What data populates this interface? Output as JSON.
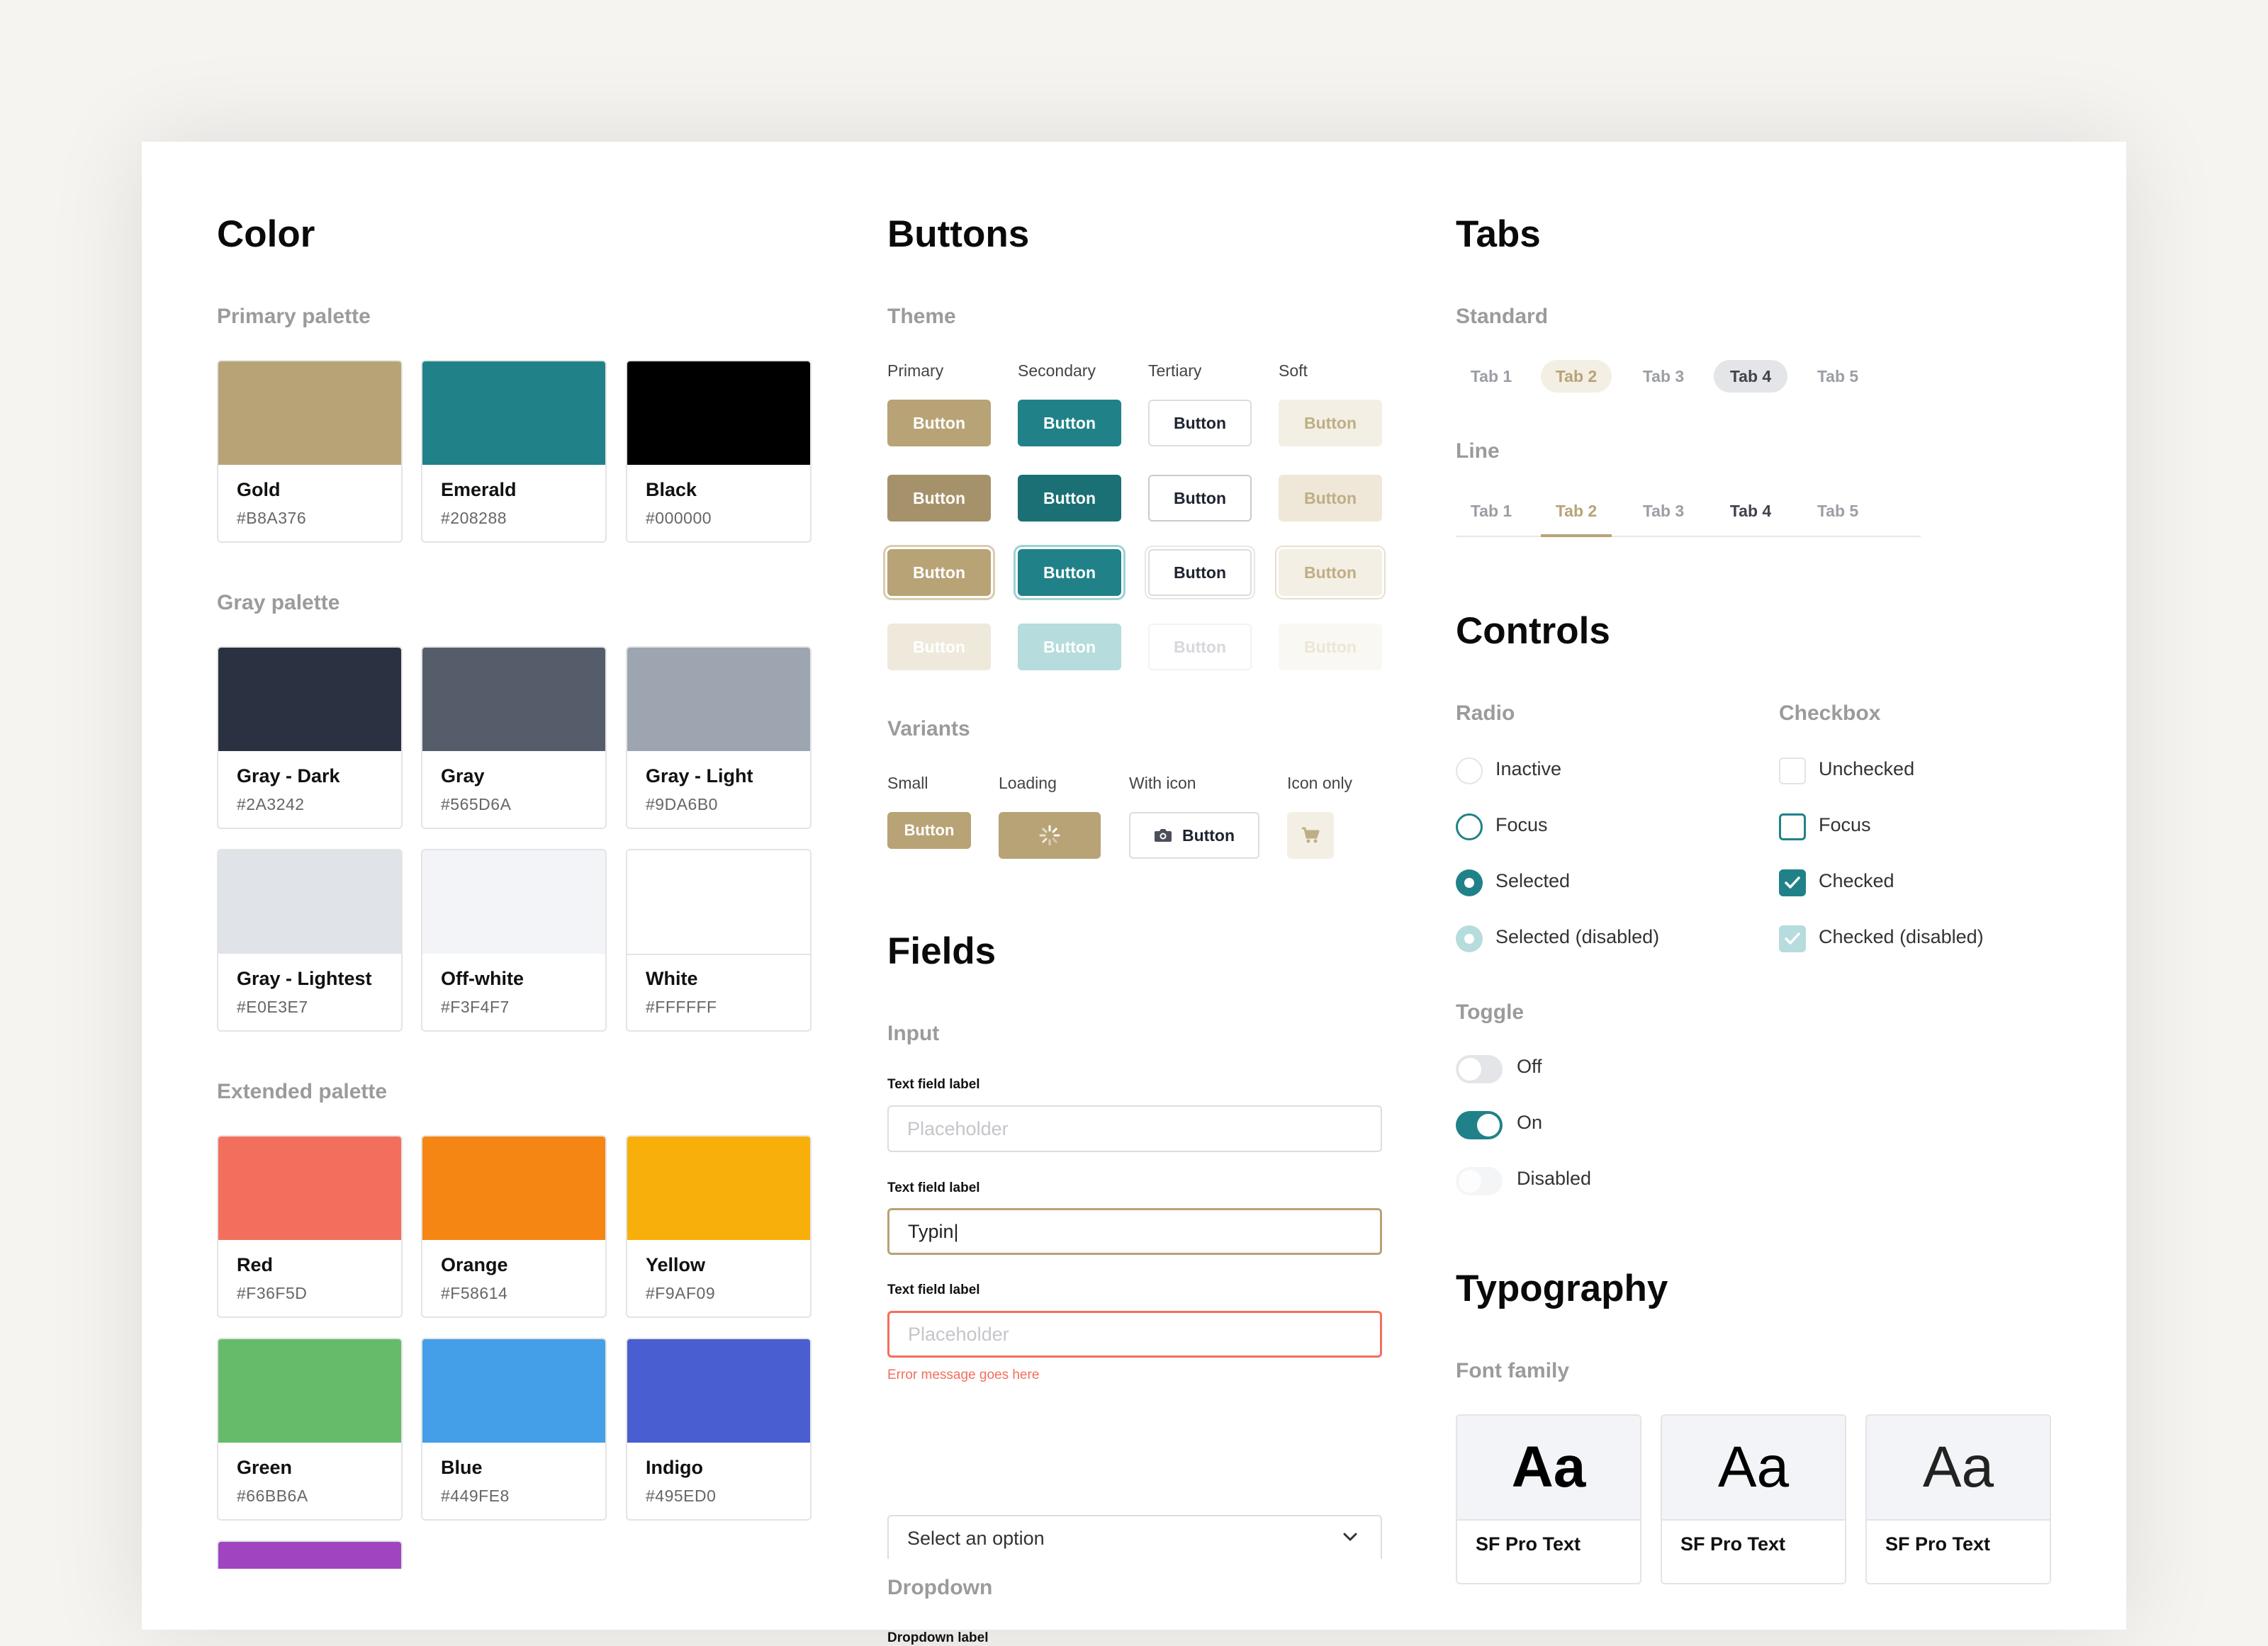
{
  "color": {
    "title": "Color",
    "primary_heading": "Primary palette",
    "gray_heading": "Gray palette",
    "extended_heading": "Extended palette",
    "primary": [
      {
        "name": "Gold",
        "hex": "#B8A376"
      },
      {
        "name": "Emerald",
        "hex": "#208288"
      },
      {
        "name": "Black",
        "hex": "#000000"
      }
    ],
    "gray": [
      {
        "name": "Gray - Dark",
        "hex": "#2A3242"
      },
      {
        "name": "Gray",
        "hex": "#565D6A"
      },
      {
        "name": "Gray - Light",
        "hex": "#9DA6B0"
      },
      {
        "name": "Gray - Lightest",
        "hex": "#E0E3E7"
      },
      {
        "name": "Off-white",
        "hex": "#F3F4F7"
      },
      {
        "name": "White",
        "hex": "#FFFFFF"
      }
    ],
    "extended": [
      {
        "name": "Red",
        "hex": "#F36F5D"
      },
      {
        "name": "Orange",
        "hex": "#F58614"
      },
      {
        "name": "Yellow",
        "hex": "#F9AF09"
      },
      {
        "name": "Green",
        "hex": "#66BB6A"
      },
      {
        "name": "Blue",
        "hex": "#449FE8"
      },
      {
        "name": "Indigo",
        "hex": "#495ED0"
      }
    ],
    "partial_swatch_color": "#A044C0"
  },
  "buttons": {
    "title": "Buttons",
    "theme_heading": "Theme",
    "columns": [
      "Primary",
      "Secondary",
      "Tertiary",
      "Soft"
    ],
    "button_label": "Button",
    "variants_heading": "Variants",
    "variant_labels": [
      "Small",
      "Loading",
      "With icon",
      "Icon only"
    ],
    "small_label": "Button",
    "with_icon_label": "Button"
  },
  "fields": {
    "title": "Fields",
    "input_heading": "Input",
    "inputs": [
      {
        "label": "Text field label",
        "placeholder": "Placeholder",
        "value": ""
      },
      {
        "label": "Text field label",
        "placeholder": "Placeholder",
        "value": "Typin|"
      },
      {
        "label": "Text field label",
        "placeholder": "Placeholder",
        "value": ""
      }
    ],
    "error_message": "Error message goes here",
    "dropdown_heading": "Dropdown",
    "dropdown_label": "Dropdown label",
    "dropdown_value": "Select an option"
  },
  "tabs": {
    "title": "Tabs",
    "standard_heading": "Standard",
    "line_heading": "Line",
    "items": [
      "Tab 1",
      "Tab 2",
      "Tab 3",
      "Tab 4",
      "Tab 5"
    ]
  },
  "controls": {
    "title": "Controls",
    "radio_heading": "Radio",
    "checkbox_heading": "Checkbox",
    "radio": [
      "Inactive",
      "Focus",
      "Selected",
      "Selected (disabled)"
    ],
    "checkbox": [
      "Unchecked",
      "Focus",
      "Checked",
      "Checked (disabled)"
    ],
    "toggle_heading": "Toggle",
    "toggle": [
      "Off",
      "On",
      "Disabled"
    ]
  },
  "typography": {
    "title": "Typography",
    "family_heading": "Font family",
    "sample": "Aa",
    "fonts": [
      "SF Pro Text",
      "SF Pro Text",
      "SF Pro Text"
    ]
  }
}
